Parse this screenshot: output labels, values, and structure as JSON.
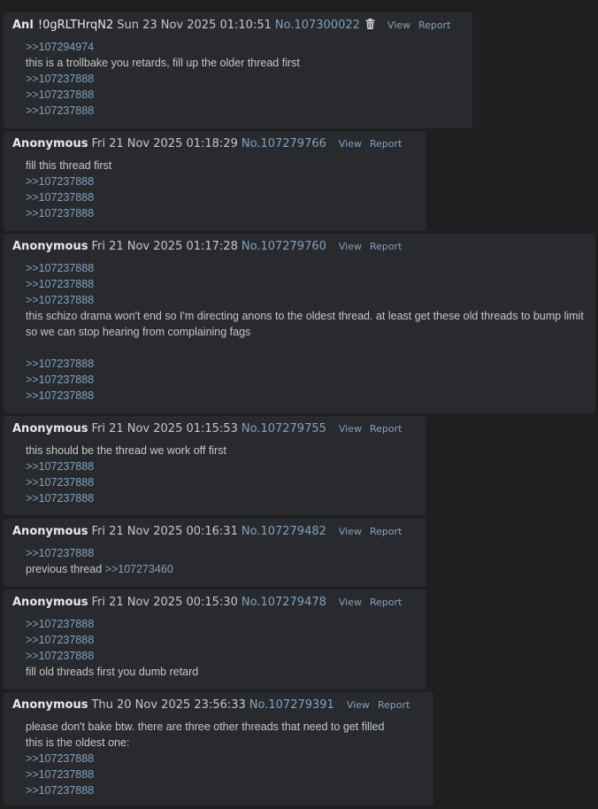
{
  "labels": {
    "view": "View",
    "report": "Report"
  },
  "posts": [
    {
      "name": "Anl",
      "trip": "!0gRLTHrqN2",
      "date": "Sun 23 Nov 2025 01:10:51",
      "no": "No.107300022",
      "trash": true,
      "body": [
        [
          {
            "q": ">>107294974"
          }
        ],
        [
          {
            "t": "this is a trollbake you retards, fill up the older thread first"
          }
        ],
        [
          {
            "q": ">>107237888"
          }
        ],
        [
          {
            "q": ">>107237888"
          }
        ],
        [
          {
            "q": ">>107237888"
          }
        ]
      ]
    },
    {
      "name": "Anonymous",
      "date": "Fri 21 Nov 2025 01:18:29",
      "no": "No.107279766",
      "body": [
        [
          {
            "t": "fill this thread first"
          }
        ],
        [
          {
            "q": ">>107237888"
          }
        ],
        [
          {
            "q": ">>107237888"
          }
        ],
        [
          {
            "q": ">>107237888"
          }
        ]
      ]
    },
    {
      "name": "Anonymous",
      "date": "Fri 21 Nov 2025 01:17:28",
      "no": "No.107279760",
      "body": [
        [
          {
            "q": ">>107237888"
          }
        ],
        [
          {
            "q": ">>107237888"
          }
        ],
        [
          {
            "q": ">>107237888"
          }
        ],
        [
          {
            "t": "this schizo drama won't end so I'm directing anons to the oldest thread. at least get these old threads to bump limit so we can stop hearing from complaining fags"
          }
        ],
        [],
        [
          {
            "q": ">>107237888"
          }
        ],
        [
          {
            "q": ">>107237888"
          }
        ],
        [
          {
            "q": ">>107237888"
          }
        ]
      ]
    },
    {
      "name": "Anonymous",
      "date": "Fri 21 Nov 2025 01:15:53",
      "no": "No.107279755",
      "body": [
        [
          {
            "t": "this should be the thread we work off first"
          }
        ],
        [
          {
            "q": ">>107237888"
          }
        ],
        [
          {
            "q": ">>107237888"
          }
        ],
        [
          {
            "q": ">>107237888"
          }
        ]
      ]
    },
    {
      "name": "Anonymous",
      "date": "Fri 21 Nov 2025 00:16:31",
      "no": "No.107279482",
      "body": [
        [
          {
            "q": ">>107237888"
          }
        ],
        [
          {
            "t": "previous thread "
          },
          {
            "q": ">>107273460"
          }
        ]
      ]
    },
    {
      "name": "Anonymous",
      "date": "Fri 21 Nov 2025 00:15:30",
      "no": "No.107279478",
      "body": [
        [
          {
            "q": ">>107237888"
          }
        ],
        [
          {
            "q": ">>107237888"
          }
        ],
        [
          {
            "q": ">>107237888"
          }
        ],
        [
          {
            "t": "fill old threads first you dumb retard"
          }
        ]
      ]
    },
    {
      "name": "Anonymous",
      "date": "Thu 20 Nov 2025 23:56:33",
      "no": "No.107279391",
      "body": [
        [
          {
            "t": "please don't bake btw. there are three other threads that need to get filled"
          }
        ],
        [
          {
            "t": "this is the oldest one:"
          }
        ],
        [
          {
            "q": ">>107237888"
          }
        ],
        [
          {
            "q": ">>107237888"
          }
        ],
        [
          {
            "q": ">>107237888"
          }
        ]
      ]
    }
  ]
}
